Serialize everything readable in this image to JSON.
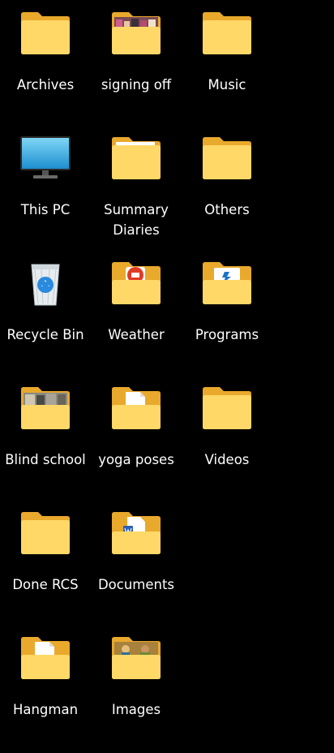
{
  "colors": {
    "background": "#000000",
    "folder_back": "#F2B838",
    "folder_front": "#FFD867",
    "label": "#FFFFFF"
  },
  "icons": [
    {
      "label": "Archives",
      "type": "folder"
    },
    {
      "label": "signing off",
      "type": "folder-photo-people"
    },
    {
      "label": "Music",
      "type": "folder"
    },
    {
      "label": "This PC",
      "type": "monitor"
    },
    {
      "label": "Summary\nDiaries",
      "type": "folder-papers"
    },
    {
      "label": "Others",
      "type": "folder"
    },
    {
      "label": "Recycle Bin",
      "type": "recycle-bin"
    },
    {
      "label": "Weather",
      "type": "folder-red-app"
    },
    {
      "label": "Programs",
      "type": "folder-app"
    },
    {
      "label": "Blind school",
      "type": "folder-photo"
    },
    {
      "label": "yoga poses",
      "type": "folder-doc"
    },
    {
      "label": "Videos",
      "type": "folder"
    },
    {
      "label": "Done RCS",
      "type": "folder"
    },
    {
      "label": "Documents",
      "type": "folder-word"
    },
    {
      "label": "Hangman",
      "type": "folder-doc"
    },
    {
      "label": "Images",
      "type": "folder-photo-art"
    }
  ]
}
